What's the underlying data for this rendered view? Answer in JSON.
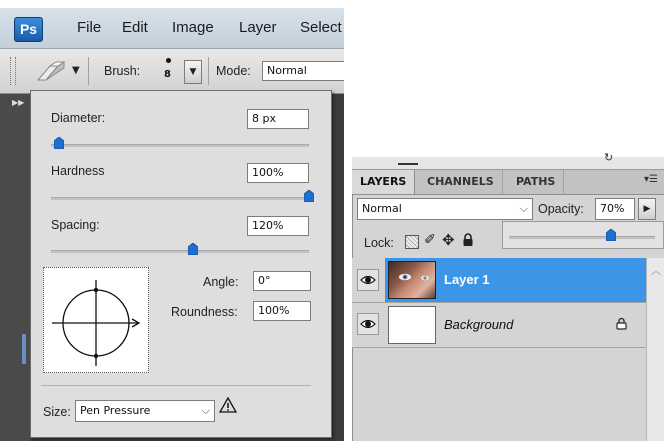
{
  "menubar": {
    "logo": "Ps",
    "items": [
      "File",
      "Edit",
      "Image",
      "Layer",
      "Select"
    ]
  },
  "options_bar": {
    "brush_label": "Brush:",
    "brush_size": "8",
    "mode_label": "Mode:",
    "mode_value": "Normal"
  },
  "brush_panel": {
    "diameter_label": "Diameter:",
    "diameter_value": "8 px",
    "diameter_level": 0.03,
    "hardness_label": "Hardness",
    "hardness_value": "100%",
    "hardness_level": 1.0,
    "spacing_label": "Spacing:",
    "spacing_value": "120%",
    "spacing_level": 0.55,
    "angle_label": "Angle:",
    "angle_value": "0°",
    "roundness_label": "Roundness:",
    "roundness_value": "100%",
    "size_label": "Size:",
    "size_value": "Pen Pressure"
  },
  "layers_panel": {
    "tabs": [
      "LAYERS",
      "CHANNELS",
      "PATHS"
    ],
    "active_tab": "LAYERS",
    "blend_mode": "Normal",
    "opacity_label": "Opacity:",
    "opacity_value": "70%",
    "opacity_level": 0.7,
    "lock_label": "Lock:",
    "layers": [
      {
        "name": "Layer 1",
        "selected": true
      },
      {
        "name": "Background",
        "selected": false,
        "locked": true
      }
    ]
  },
  "colors": {
    "selected_layer": "#3d95e8",
    "slider_thumb": "#1e6fd0"
  }
}
